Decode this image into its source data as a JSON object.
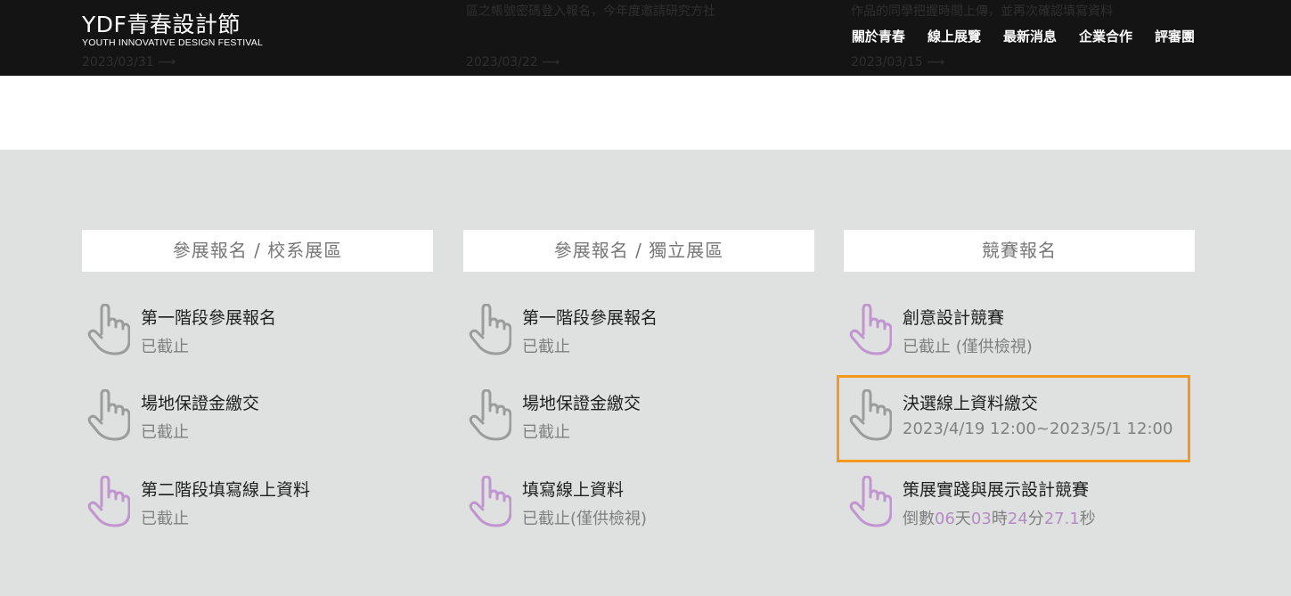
{
  "header": {
    "logo_main": "YDF青春設計節",
    "logo_sub": "YOUTH INNOVATIVE DESIGN FESTIVAL",
    "nav": [
      "關於青春",
      "線上展覽",
      "最新消息",
      "企業合作",
      "評審團"
    ],
    "ghost": {
      "text1": "區之帳號密碼登入報名，今年度邀請研究方社",
      "text2": "作品的同學把握時間上傳，並再次確認填寫資料",
      "date1": "2023/03/31 ⟶",
      "date2": "2023/03/22 ⟶",
      "date3": "2023/03/15 ⟶"
    }
  },
  "colors": {
    "hand_gray": "#9c9c9c",
    "hand_purple": "#c195cf",
    "highlight": "#f39a1e",
    "countdown_number": "#b58bc4"
  },
  "columns": [
    {
      "title": "參展報名 / 校系展區",
      "items": [
        {
          "title": "第一階段參展報名",
          "status": "已截止",
          "icon": "pointing-hand-icon",
          "color": "gray"
        },
        {
          "title": "場地保證金繳交",
          "status": "已截止",
          "icon": "pointing-hand-icon",
          "color": "gray"
        },
        {
          "title": "第二階段填寫線上資料",
          "status": "已截止",
          "icon": "pointing-hand-icon",
          "color": "purple"
        }
      ]
    },
    {
      "title": "參展報名 / 獨立展區",
      "items": [
        {
          "title": "第一階段參展報名",
          "status": "已截止",
          "icon": "pointing-hand-icon",
          "color": "gray"
        },
        {
          "title": "場地保證金繳交",
          "status": "已截止",
          "icon": "pointing-hand-icon",
          "color": "gray"
        },
        {
          "title": "填寫線上資料",
          "status": "已截止(僅供檢視)",
          "icon": "pointing-hand-icon",
          "color": "purple"
        }
      ]
    },
    {
      "title": "競賽報名",
      "items": [
        {
          "title": "創意設計競賽",
          "status": "已截止 (僅供檢視)",
          "icon": "pointing-hand-icon",
          "color": "purple"
        },
        {
          "title": "決選線上資料繳交",
          "status": "2023/4/19 12:00~2023/5/1 12:00",
          "icon": "pointing-hand-icon",
          "color": "gray"
        },
        {
          "title": "策展實踐與展示設計競賽",
          "icon": "pointing-hand-icon",
          "color": "purple",
          "countdown": {
            "prefix": "倒數",
            "days": "06",
            "days_unit": "天",
            "hours": "03",
            "hours_unit": "時",
            "minutes": "24",
            "minutes_unit": "分",
            "seconds": "27.1",
            "seconds_unit": "秒"
          }
        }
      ]
    }
  ]
}
